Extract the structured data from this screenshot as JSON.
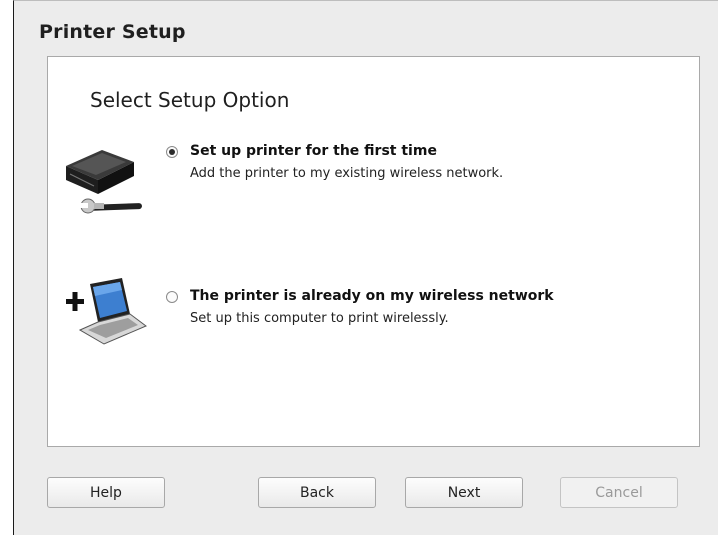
{
  "window": {
    "title": "Printer Setup"
  },
  "main": {
    "section_title": "Select Setup Option",
    "options": [
      {
        "title": "Set up printer for the first time",
        "description": "Add the printer to my existing wireless network.",
        "selected": true,
        "icon": "printer-wrench-icon"
      },
      {
        "title": "The printer is already on my wireless network",
        "description": "Set up this computer to print wirelessly.",
        "selected": false,
        "icon": "add-laptop-icon"
      }
    ]
  },
  "footer": {
    "help_label": "Help",
    "back_label": "Back",
    "next_label": "Next",
    "cancel_label": "Cancel",
    "cancel_enabled": false
  }
}
